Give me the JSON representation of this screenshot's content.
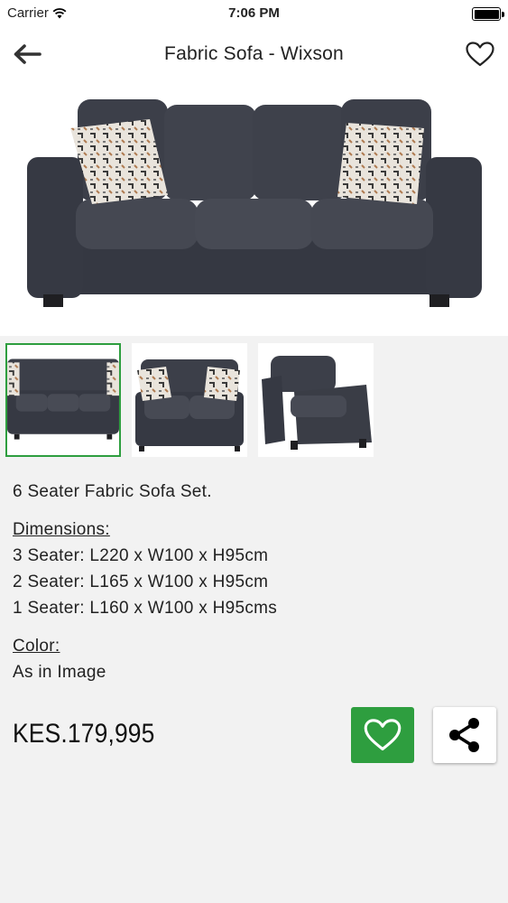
{
  "status_bar": {
    "carrier": "Carrier",
    "time": "7:06 PM"
  },
  "nav": {
    "title": "Fabric Sofa - Wixson"
  },
  "icons": {
    "back": "arrow-left-icon",
    "favorite": "heart-outline-icon",
    "wifi": "wifi-icon",
    "battery": "battery-icon",
    "wishlist": "heart-icon",
    "share": "share-icon"
  },
  "colors": {
    "accent_green": "#2e9e3f",
    "sofa_fabric": "#3a3d46"
  },
  "product": {
    "summary": "6 Seater Fabric Sofa Set.",
    "dimensions_heading": "Dimensions:",
    "dimensions": [
      "3 Seater: L220 x W100 x H95cm",
      "2 Seater: L165 x W100 x H95cm",
      "1 Seater: L160 x W100 x H95cms"
    ],
    "color_heading": "Color:",
    "color_value": "As in Image",
    "price": "KES.179,995"
  },
  "thumbnails": [
    {
      "name": "3 seater sofa",
      "selected": true
    },
    {
      "name": "2 seater sofa",
      "selected": false
    },
    {
      "name": "1 seater armchair",
      "selected": false
    }
  ]
}
